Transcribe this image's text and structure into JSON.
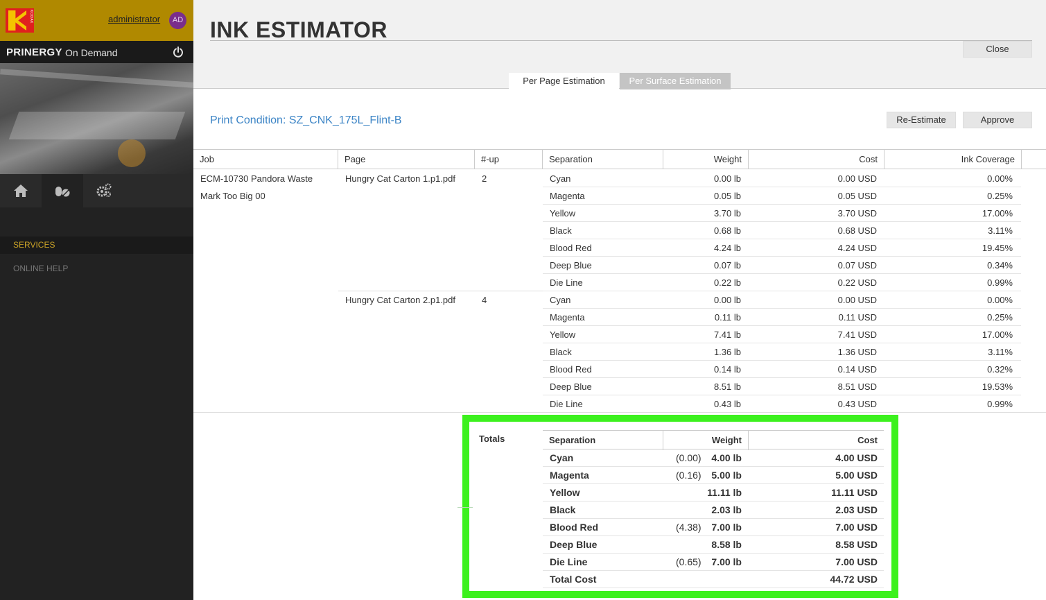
{
  "sidebar": {
    "user_name": "administrator",
    "avatar_initials": "AD",
    "brand_main": "PRINERGY",
    "brand_sub": "On Demand",
    "logo_text": "KODAK",
    "nav_icons": [
      "home-icon",
      "pills-icon",
      "gears-icon"
    ],
    "menu": {
      "services": "SERVICES",
      "online_help": "ONLINE HELP"
    }
  },
  "header": {
    "title": "INK ESTIMATOR",
    "close_label": "Close",
    "tabs": [
      {
        "label": "Per Page Estimation",
        "active": true
      },
      {
        "label": "Per Surface Estimation",
        "active": false
      }
    ]
  },
  "print_condition": "Print Condition: SZ_CNK_175L_Flint-B",
  "actions": {
    "re_estimate": "Re-Estimate",
    "approve": "Approve"
  },
  "table": {
    "columns": [
      "Job",
      "Page",
      "#-up",
      "Separation",
      "Weight",
      "Cost",
      "Ink Coverage"
    ],
    "job": "ECM-10730 Pandora Waste Mark Too Big 00",
    "pages": [
      {
        "name": "Hungry Cat Carton 1.p1.pdf",
        "nup": "2",
        "rows": [
          {
            "sep": "Cyan",
            "weight": "0.00  lb",
            "cost": "0.00 USD",
            "coverage": "0.00%"
          },
          {
            "sep": "Magenta",
            "weight": "0.05  lb",
            "cost": "0.05 USD",
            "coverage": "0.25%"
          },
          {
            "sep": "Yellow",
            "weight": "3.70  lb",
            "cost": "3.70 USD",
            "coverage": "17.00%"
          },
          {
            "sep": "Black",
            "weight": "0.68  lb",
            "cost": "0.68 USD",
            "coverage": "3.11%"
          },
          {
            "sep": "Blood Red",
            "weight": "4.24  lb",
            "cost": "4.24 USD",
            "coverage": "19.45%"
          },
          {
            "sep": "Deep Blue",
            "weight": "0.07  lb",
            "cost": "0.07 USD",
            "coverage": "0.34%"
          },
          {
            "sep": "Die Line",
            "weight": "0.22  lb",
            "cost": "0.22 USD",
            "coverage": "0.99%"
          }
        ]
      },
      {
        "name": "Hungry Cat Carton 2.p1.pdf",
        "nup": "4",
        "rows": [
          {
            "sep": "Cyan",
            "weight": "0.00  lb",
            "cost": "0.00 USD",
            "coverage": "0.00%"
          },
          {
            "sep": "Magenta",
            "weight": "0.11  lb",
            "cost": "0.11 USD",
            "coverage": "0.25%"
          },
          {
            "sep": "Yellow",
            "weight": "7.41  lb",
            "cost": "7.41 USD",
            "coverage": "17.00%"
          },
          {
            "sep": "Black",
            "weight": "1.36  lb",
            "cost": "1.36 USD",
            "coverage": "3.11%"
          },
          {
            "sep": "Blood Red",
            "weight": "0.14  lb",
            "cost": "0.14 USD",
            "coverage": "0.32%"
          },
          {
            "sep": "Deep Blue",
            "weight": "8.51  lb",
            "cost": "8.51 USD",
            "coverage": "19.53%"
          },
          {
            "sep": "Die Line",
            "weight": "0.43  lb",
            "cost": "0.43 USD",
            "coverage": "0.99%"
          }
        ]
      }
    ]
  },
  "totals": {
    "label": "Totals",
    "columns": [
      "Separation",
      "Weight",
      "Cost"
    ],
    "rows": [
      {
        "sep": "Cyan",
        "adj": "(0.00)",
        "weight": "4.00 lb",
        "cost": "4.00 USD"
      },
      {
        "sep": "Magenta",
        "adj": "(0.16)",
        "weight": "5.00 lb",
        "cost": "5.00 USD"
      },
      {
        "sep": "Yellow",
        "adj": "",
        "weight": "11.11 lb",
        "cost": "11.11 USD"
      },
      {
        "sep": "Black",
        "adj": "",
        "weight": "2.03 lb",
        "cost": "2.03 USD"
      },
      {
        "sep": "Blood Red",
        "adj": "(4.38)",
        "weight": "7.00 lb",
        "cost": "7.00 USD"
      },
      {
        "sep": "Deep Blue",
        "adj": "",
        "weight": "8.58 lb",
        "cost": "8.58 USD"
      },
      {
        "sep": "Die Line",
        "adj": "(0.65)",
        "weight": "7.00 lb",
        "cost": "7.00 USD"
      }
    ],
    "total_cost_label": "Total Cost",
    "total_cost": "44.72 USD"
  },
  "colors": {
    "sidebar_bg": "#222222",
    "topbar_gold": "#b08900",
    "services_gold": "#c9a227",
    "link_blue": "#3d85c6",
    "highlight_green": "#3cf11e",
    "avatar_purple": "#7a2d8c"
  }
}
